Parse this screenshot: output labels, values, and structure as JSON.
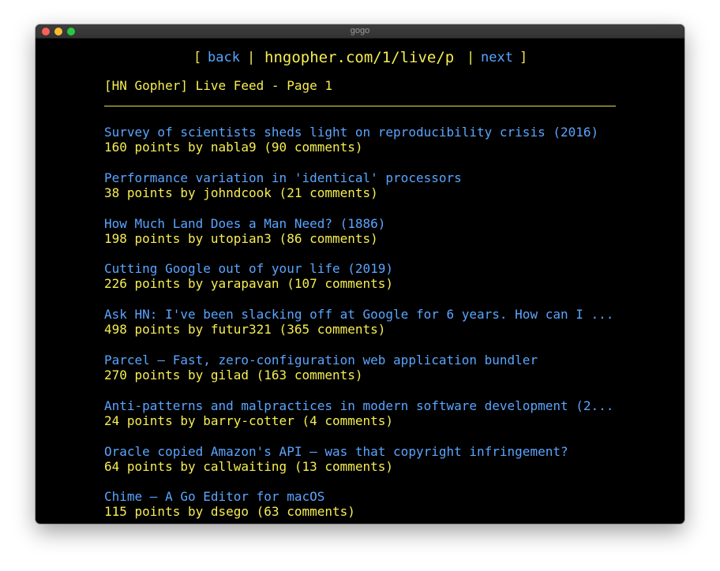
{
  "window": {
    "title": "gogo"
  },
  "nav": {
    "back_open": "[",
    "back_label": "back",
    "back_close": "|",
    "url": "hngopher.com/1/live/p",
    "next_open": "|",
    "next_label": "next",
    "next_close": "]"
  },
  "page": {
    "header": "[HN Gopher] Live Feed - Page 1"
  },
  "items": [
    {
      "title": "Survey of scientists sheds light on reproducibility crisis (2016)",
      "meta": "160 points by nabla9 (90 comments)"
    },
    {
      "title": "Performance variation in 'identical' processors",
      "meta": "38 points by johndcook (21 comments)"
    },
    {
      "title": "How Much Land Does a Man Need? (1886)",
      "meta": "198 points by utopian3 (86 comments)"
    },
    {
      "title": "Cutting Google out of your life (2019)",
      "meta": "226 points by yarapavan (107 comments)"
    },
    {
      "title": "Ask HN: I've been slacking off at Google for 6 years. How can I ...",
      "meta": "498 points by futur321 (365 comments)"
    },
    {
      "title": "Parcel – Fast, zero-configuration web application bundler",
      "meta": "270 points by gilad (163 comments)"
    },
    {
      "title": "Anti-patterns and malpractices in modern software development (2...",
      "meta": "24 points by barry-cotter (4 comments)"
    },
    {
      "title": "Oracle copied Amazon's API – was that copyright infringement?",
      "meta": "64 points by callwaiting (13 comments)"
    },
    {
      "title": "Chime – A Go Editor for macOS",
      "meta": "115 points by dsego (63 comments)"
    }
  ],
  "colors": {
    "background": "#000000",
    "link": "#5aa5ff",
    "text": "#f6ee52"
  }
}
